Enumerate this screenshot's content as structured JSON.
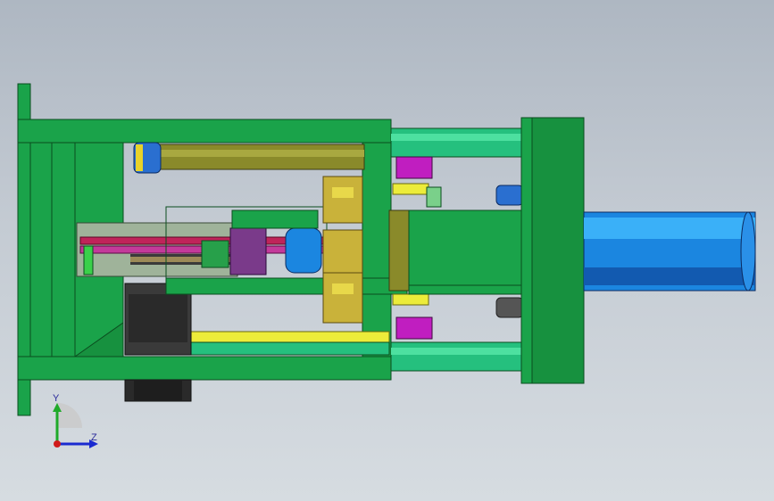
{
  "viewport": {
    "background_top": "#aeb7c2",
    "background_bottom": "#d6dce1"
  },
  "colors": {
    "frame_green": "#1aa34a",
    "frame_edge": "#0b4d1f",
    "shaft_yellow": "#ecec3a",
    "guide_teal": "#25c07e",
    "cylinder_blue": "#1b86e0",
    "motor_black": "#2a2a2a",
    "rack_red": "#c0245a",
    "bearing_gold": "#c9b23a",
    "collar_magenta": "#c01ec0"
  },
  "triad": {
    "y_label": "Y",
    "z_label": "Z",
    "y_color": "#1faa2a",
    "z_color": "#1a2ad0",
    "origin_color": "#d01a1a"
  }
}
